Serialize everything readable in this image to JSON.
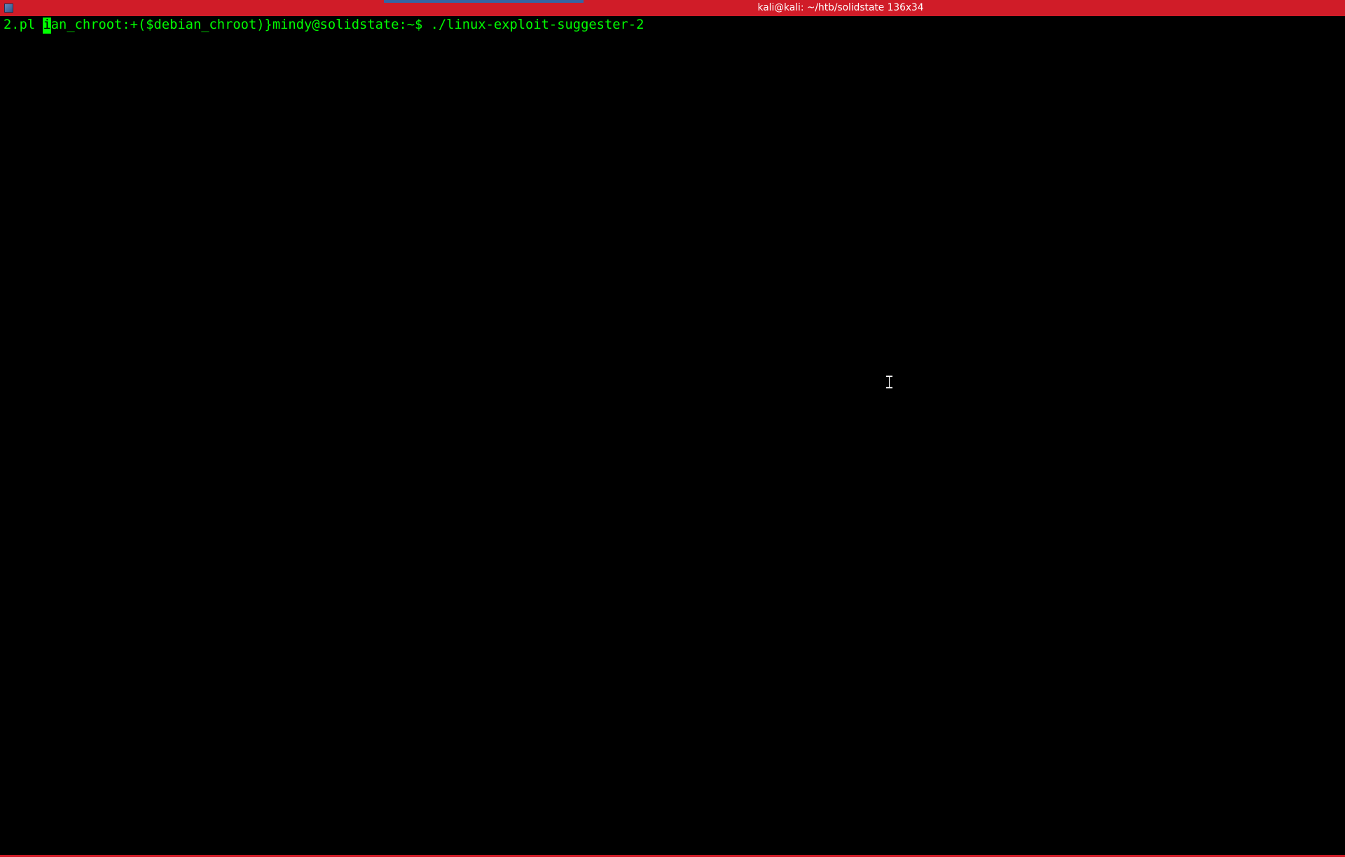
{
  "titlebar": {
    "title": "kali@kali: ~/htb/solidstate 136x34"
  },
  "terminal": {
    "line1_prefix": "2.pl ",
    "line1_cursor_char": "i",
    "line1_text": "an_chroot:+($debian_chroot)}mindy@solidstate:~$ ./linux-exploit-suggester-2"
  }
}
